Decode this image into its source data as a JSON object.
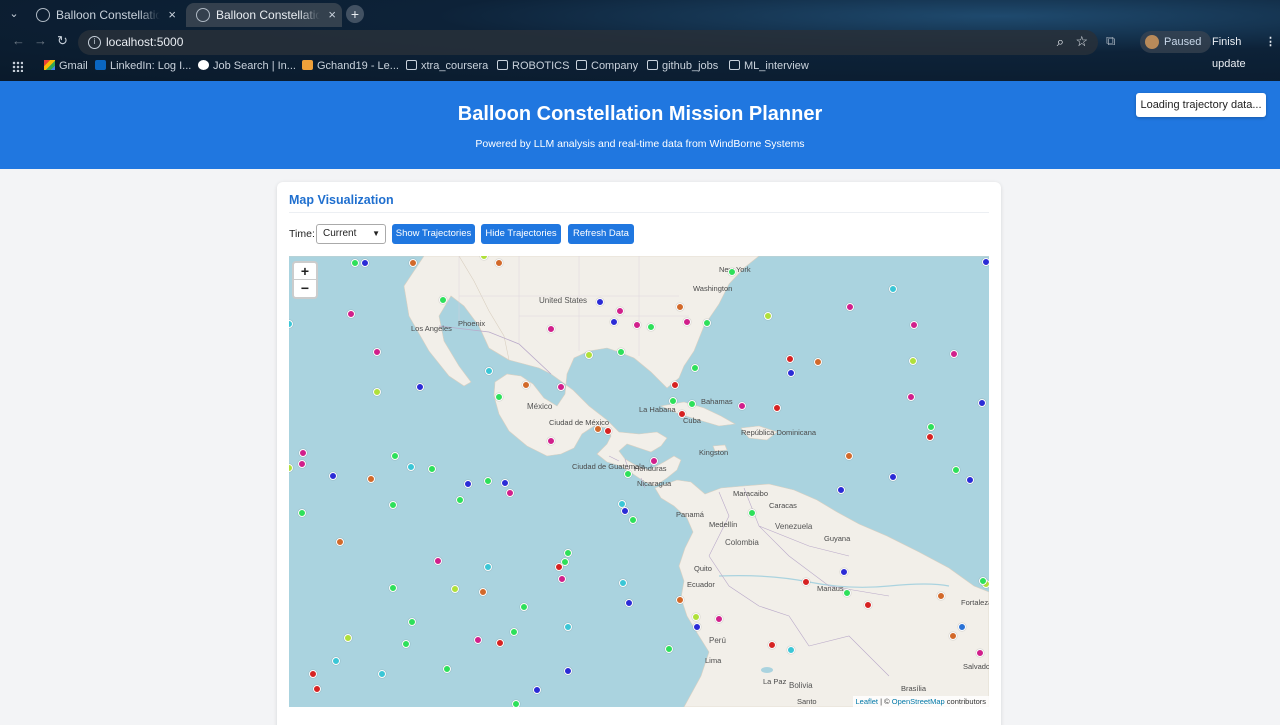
{
  "browser": {
    "tabs": [
      {
        "title": "Balloon Constellation Mission Planner",
        "active": true
      },
      {
        "title": "Balloon Constellation Mission Planner",
        "active": false
      }
    ],
    "tab_close": "×",
    "new_tab": "+",
    "url": "localhost:5000",
    "profile_status": "Paused",
    "update_label": "Finish update",
    "menu": "⋮",
    "bookmarks": [
      {
        "label": "Gmail",
        "icon": "gmail-icon"
      },
      {
        "label": "LinkedIn: Log I...",
        "icon": "linkedin-icon"
      },
      {
        "label": "Job Search | In...",
        "icon": "info-icon"
      },
      {
        "label": "Gchand19 - Le...",
        "icon": "leetcode-icon"
      },
      {
        "label": "xtra_coursera",
        "icon": "folder-icon"
      },
      {
        "label": "ROBOTICS",
        "icon": "folder-icon"
      },
      {
        "label": "Company",
        "icon": "folder-icon"
      },
      {
        "label": "github_jobs",
        "icon": "folder-icon"
      },
      {
        "label": "ML_interview",
        "icon": "folder-icon"
      }
    ]
  },
  "header": {
    "title": "Balloon Constellation Mission Planner",
    "subtitle": "Powered by LLM analysis and real-time data from WindBorne Systems",
    "status": "Loading trajectory data..."
  },
  "card": {
    "title": "Map Visualization",
    "time_label": "Time:",
    "time_value": "Current",
    "buttons": {
      "show": "Show Trajectories",
      "hide": "Hide Trajectories",
      "refresh": "Refresh Data"
    }
  },
  "map": {
    "zoom_in": "+",
    "zoom_out": "−",
    "attribution": {
      "leaflet": "Leaflet",
      "sep": " | © ",
      "osm": "OpenStreetMap",
      "tail": " contributors"
    },
    "labels": {
      "united_states": "United States",
      "los_angeles": "Los Angeles",
      "phoenix": "Phoenix",
      "washington": "Washington",
      "new_york": "New York",
      "mexico": "México",
      "ciudad_mexico": "Ciudad de México",
      "la_habana": "La Habana",
      "bahamas": "Bahamas",
      "cuba": "Cuba",
      "republica_dominicana": "República Dominicana",
      "kingston": "Kingston",
      "ciudad_guatemala": "Ciudad de Guatemala",
      "honduras": "Honduras",
      "nicaragua": "Nicaragua",
      "panama": "Panamá",
      "maracaibo": "Maracaibo",
      "caracas": "Caracas",
      "medellin": "Medellín",
      "venezuela": "Venezuela",
      "colombia": "Colombia",
      "guyana": "Guyana",
      "quito": "Quito",
      "ecuador": "Ecuador",
      "manaus": "Manaus",
      "peru": "Perú",
      "lima": "Lima",
      "fortaleza": "Fortaleza",
      "salvador": "Salvador",
      "la_paz": "La Paz",
      "bolivia": "Bolivia",
      "brasilia": "Brasília",
      "santo": "Santo"
    },
    "colors": {
      "ocean": "#aad3df",
      "land": "#f2efe9",
      "balloon_palette": [
        "#2ee05a",
        "#2b2bd6",
        "#d2692a",
        "#d11f8b",
        "#3bc6d6",
        "#d62222",
        "#b0e03a",
        "#2a72d6",
        "#9b22d6"
      ]
    }
  }
}
